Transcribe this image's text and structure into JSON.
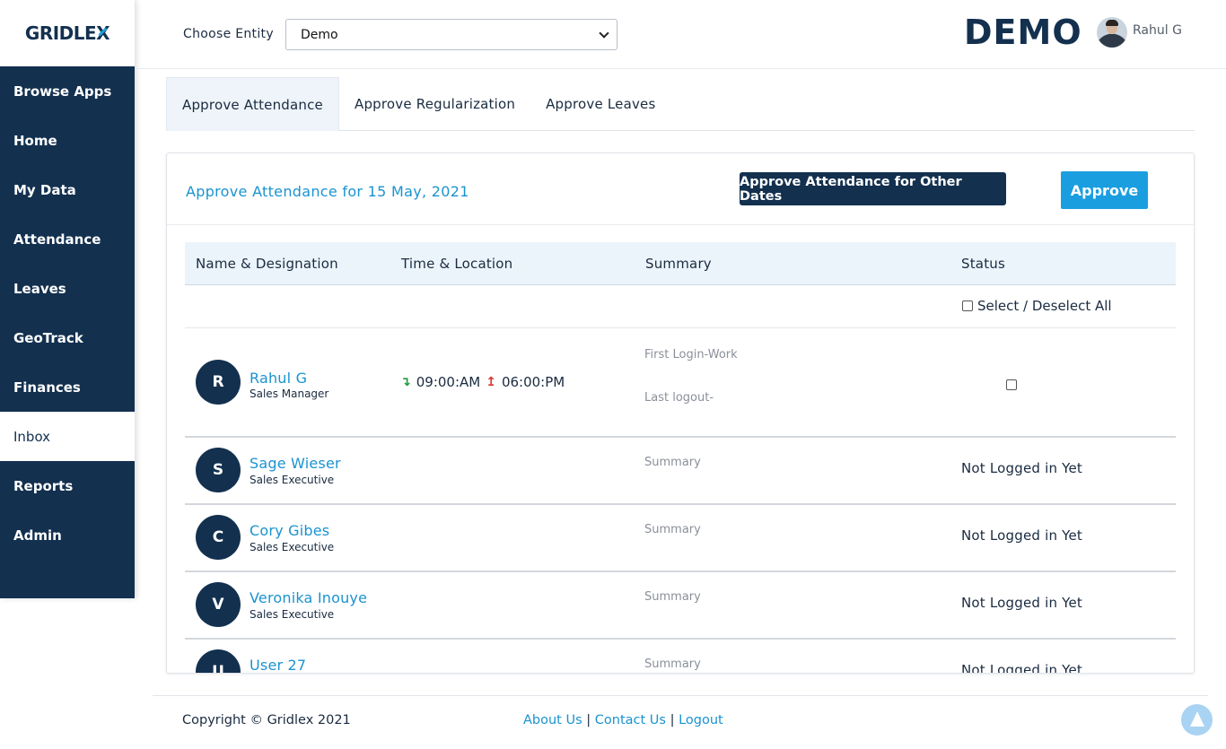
{
  "app": {
    "logo_prefix": "GRIDLE",
    "logo_x": "X",
    "brand": "DEMO",
    "user_name": "Rahul G"
  },
  "sidebar": {
    "items": [
      {
        "label": "Browse Apps"
      },
      {
        "label": "Home"
      },
      {
        "label": "My Data"
      },
      {
        "label": "Attendance"
      },
      {
        "label": "Leaves"
      },
      {
        "label": "GeoTrack"
      },
      {
        "label": "Finances"
      },
      {
        "label": "Inbox",
        "active": true
      },
      {
        "label": "Reports"
      },
      {
        "label": "Admin"
      }
    ]
  },
  "header": {
    "entity_label": "Choose Entity",
    "entity_value": "Demo"
  },
  "tabs": [
    {
      "label": "Approve Attendance",
      "active": true
    },
    {
      "label": "Approve Regularization"
    },
    {
      "label": "Approve Leaves"
    }
  ],
  "card": {
    "title": "Approve Attendance for 15 May, 2021",
    "other_dates_button": "Approve Attendance for Other Dates",
    "approve_button": "Approve"
  },
  "table": {
    "headers": {
      "name": "Name & Designation",
      "time": "Time & Location",
      "summary": "Summary",
      "status": "Status"
    },
    "select_all_label": "Select / Deselect All",
    "rows": [
      {
        "initial": "R",
        "name": "Rahul G",
        "designation": "Sales Manager",
        "time_in": "09:00:AM",
        "time_out": "06:00:PM",
        "summary_line1": "First Login-Work",
        "summary_line2": "Last logout-",
        "status": ""
      },
      {
        "initial": "S",
        "name": "Sage Wieser",
        "designation": "Sales Executive",
        "summary": "Summary",
        "status": "Not Logged in Yet"
      },
      {
        "initial": "C",
        "name": "Cory Gibes",
        "designation": "Sales Executive",
        "summary": "Summary",
        "status": "Not Logged in Yet"
      },
      {
        "initial": "V",
        "name": "Veronika Inouye",
        "designation": "Sales Executive",
        "summary": "Summary",
        "status": "Not Logged in Yet"
      },
      {
        "initial": "U",
        "name": "User 27",
        "designation": "",
        "summary": "Summary",
        "status": "Not Logged in Yet"
      }
    ]
  },
  "footer": {
    "copyright": "Copyright © Gridlex 2021",
    "about": "About Us",
    "contact": "Contact Us",
    "logout": "Logout",
    "separator": " | "
  }
}
